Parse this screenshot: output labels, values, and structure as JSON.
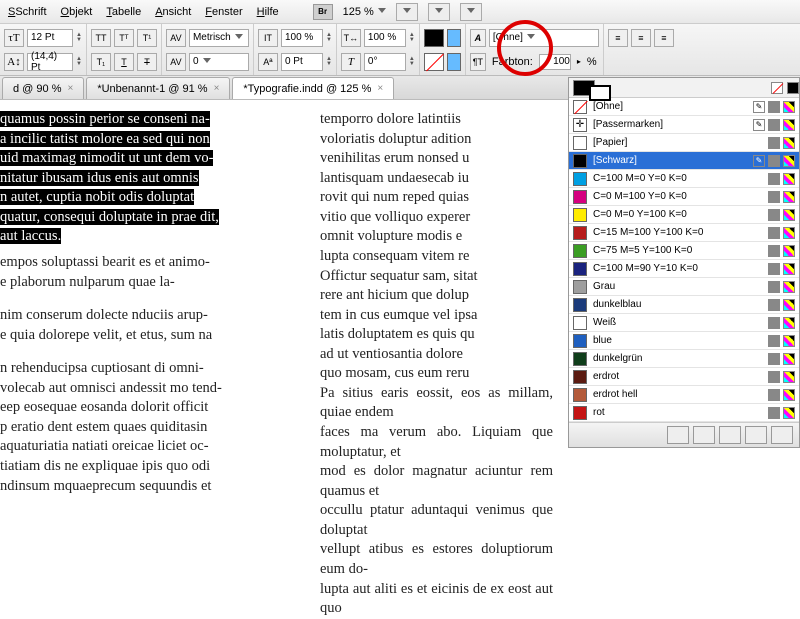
{
  "menu": {
    "items": [
      "Schrift",
      "Objekt",
      "Tabelle",
      "Ansicht",
      "Fenster",
      "Hilfe"
    ],
    "br": "Br",
    "zoom": "125 %"
  },
  "toolbar": {
    "size1": "12 Pt",
    "size2": "(14,4) Pt",
    "metric": "Metrisch",
    "kern": "0",
    "hscale": "100 %",
    "vscale": "100 %",
    "baseline": "0 Pt",
    "skew": "0°",
    "style": "[Ohne]"
  },
  "swatch_header": {
    "label": "Farbton:",
    "value": "100",
    "unit": "%"
  },
  "tabs": [
    {
      "label": "d @ 90 %",
      "active": false
    },
    {
      "label": "*Unbenannt-1 @ 91 %",
      "active": false
    },
    {
      "label": "*Typografie.indd @ 125 %",
      "active": true
    }
  ],
  "swatches": [
    {
      "name": "[Ohne]",
      "color": "none",
      "locked": true
    },
    {
      "name": "[Passermarken]",
      "color": "reg",
      "locked": true
    },
    {
      "name": "[Papier]",
      "color": "#ffffff"
    },
    {
      "name": "[Schwarz]",
      "color": "#000000",
      "locked": true,
      "selected": true
    },
    {
      "name": "C=100 M=0 Y=0 K=0",
      "color": "#00a0e3"
    },
    {
      "name": "C=0 M=100 Y=0 K=0",
      "color": "#d5007f"
    },
    {
      "name": "C=0 M=0 Y=100 K=0",
      "color": "#ffec00"
    },
    {
      "name": "C=15 M=100 Y=100 K=0",
      "color": "#b71c1c"
    },
    {
      "name": "C=75 M=5 Y=100 K=0",
      "color": "#3a9d23"
    },
    {
      "name": "C=100 M=90 Y=10 K=0",
      "color": "#1a237e"
    },
    {
      "name": "Grau",
      "color": "#9e9e9e"
    },
    {
      "name": "dunkelblau",
      "color": "#1a3a7a"
    },
    {
      "name": "Weiß",
      "color": "#ffffff"
    },
    {
      "name": "blue",
      "color": "#1e5fbf"
    },
    {
      "name": "dunkelgrün",
      "color": "#0f3d1a"
    },
    {
      "name": "erdrot",
      "color": "#5a1a10"
    },
    {
      "name": "erdrot hell",
      "color": "#b35a3a"
    },
    {
      "name": "rot",
      "color": "#c41414"
    }
  ],
  "text": {
    "col1_sel": "quamus possin perior se conseni na-\na incilic tatist molore ea sed qui non\nuid maximag nimodit ut unt dem vo-\nnitatur ibusam idus enis aut omnis\nn autet, cuptia nobit odis doluptat\nquatur, consequi doluptate in prae dit,\naut laccus.",
    "col1_p2": "empos soluptassi bearit es et animo-\ne plaborum nulparum quae la-",
    "col1_p3": "nim conserum dolecte nduciis arup-\ne quia dolorepe velit, et etus, sum na",
    "col1_p4": "n rehenducipsa cuptiosant di omni-\nvolecab aut omnisci andessit mo tend-\neep eosequae eosanda dolorit officit\np eratio dent estem quaes quiditasin\naquaturiatia natiati oreicae liciet oc-\ntiatiam dis ne expliquae ipis quo odi\nndinsum mquaeprecum sequundis et",
    "col2": "temporro dolore latintiis\nvoloriatis doluptur adition\nvenihilitas erum nonsed u\nlantisquam undaesecab iu\nrovit qui num reped quias\nvitio que volliquo experer\nomnit volupture modis e\nlupta consequam vitem re\nOffictur sequatur sam, sitat\nrere ant hicium que dolup\ntem in cus eumque vel ipsa\nlatis doluptatem es quis qu\nad ut ventiosantia dolore\nquo mosam, cus eum reru\nPa sitius earis eossit, eos as millam, quiae endem\nfaces ma verum abo. Liquiam que moluptatur, et\nmod es dolor magnatur aciuntur rem quamus et\noccullu ptatur aduntaqui venimus que doluptat\nvellupt atibus es estores doluptiorum eum do-\nlupta aut aliti es et eicinis de ex eost aut quo"
  }
}
